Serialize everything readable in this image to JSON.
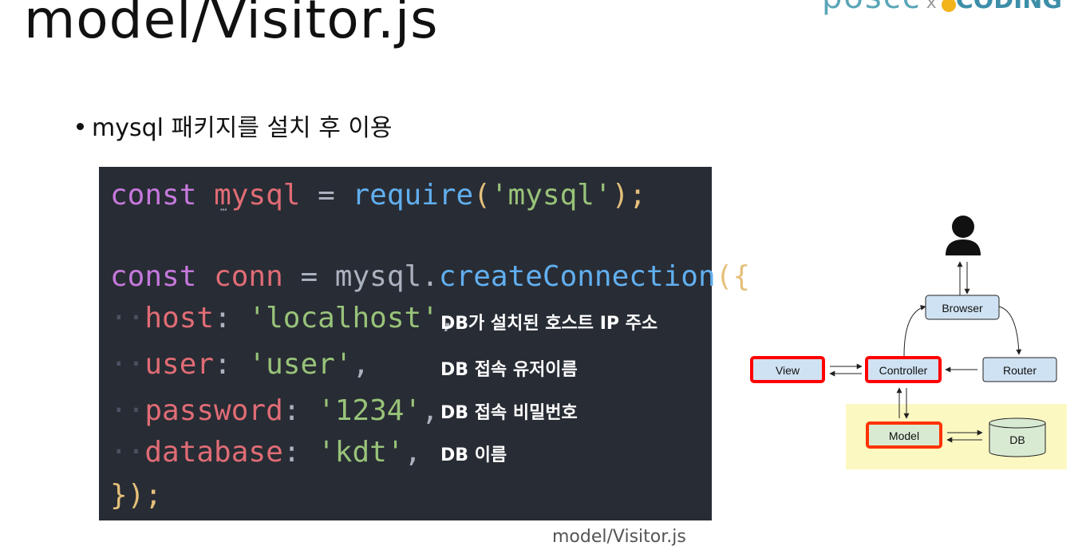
{
  "page": {
    "title": "model/Visitor.js",
    "logo": {
      "left": "poscc",
      "x": "x",
      "right": "CODING"
    },
    "bullet": "mysql 패키지를 설치 후 이용",
    "caption": "model/Visitor.js"
  },
  "code": {
    "line1": {
      "kw": "const",
      "var": "mysql",
      "op": " = ",
      "fn": "require",
      "open": "(",
      "str": "'mysql'",
      "close": ");"
    },
    "line2": {
      "kw": "const",
      "var": "conn",
      "op": " = ",
      "obj": "mysql",
      "dot": ".",
      "fn": "createConnection",
      "open": "({"
    },
    "props": [
      {
        "key": "host",
        "value": "'localhost'",
        "note": "DB가 설치된 호스트 IP 주소"
      },
      {
        "key": "user",
        "value": "'user'",
        "note": "DB 접속 유저이름"
      },
      {
        "key": "password",
        "value": "'1234'",
        "note": "DB 접속 비밀번호"
      },
      {
        "key": "database",
        "value": "'kdt'",
        "note": "DB 이름"
      }
    ],
    "end": "});"
  },
  "diagram": {
    "nodes": {
      "browser": "Browser",
      "view": "View",
      "controller": "Controller",
      "router": "Router",
      "model": "Model",
      "db": "DB"
    },
    "colors": {
      "box": "#cfe2f3",
      "model_box": "#d9ead3",
      "highlight": "#ff0000",
      "model_area": "#fcf8c2"
    }
  }
}
